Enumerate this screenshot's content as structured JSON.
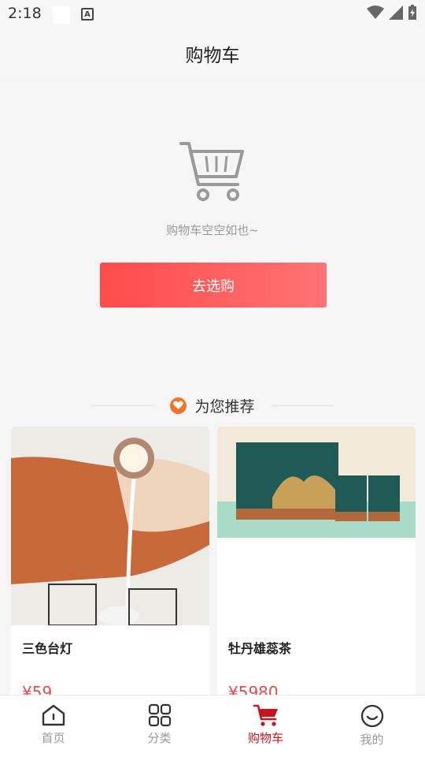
{
  "status_bar": {
    "time": "2:18"
  },
  "header": {
    "title": "购物车"
  },
  "empty_cart": {
    "message": "购物车空空如也~",
    "button_label": "去选购"
  },
  "recommend": {
    "title": "为您推荐"
  },
  "products": [
    {
      "name": "三色台灯",
      "price": "¥59"
    },
    {
      "name": "牡丹雄蕊茶",
      "price": "¥5980"
    }
  ],
  "tabbar": {
    "items": [
      {
        "label": "首页",
        "icon": "home-icon",
        "active": false
      },
      {
        "label": "分类",
        "icon": "category-icon",
        "active": false
      },
      {
        "label": "购物车",
        "icon": "cart-icon",
        "active": true
      },
      {
        "label": "我的",
        "icon": "profile-icon",
        "active": false
      }
    ]
  },
  "colors": {
    "accent": "#ff4b4b",
    "active_tab": "#c8141e",
    "price": "#e84a4a"
  }
}
